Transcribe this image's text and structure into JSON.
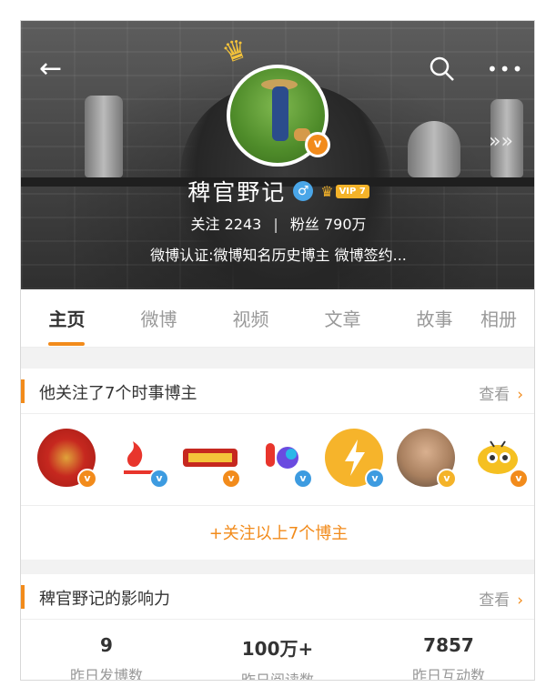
{
  "header": {
    "back_icon": "←",
    "search_icon": "⚲",
    "more_icon": "•••",
    "forward_icon": "»»",
    "name": "稗官野记",
    "gender_icon": "♂",
    "vip_label": "VIP 7",
    "verified_symbol": "v",
    "follow_label": "关注",
    "follow_count": "2243",
    "separator": "|",
    "fans_label": "粉丝",
    "fans_count": "790万",
    "certification": "微博认证:微博知名历史博主 微博签约..."
  },
  "tabs": [
    {
      "label": "主页",
      "active": true
    },
    {
      "label": "微博",
      "active": false
    },
    {
      "label": "视频",
      "active": false
    },
    {
      "label": "文章",
      "active": false
    },
    {
      "label": "故事",
      "active": false
    },
    {
      "label": "相册",
      "active": false
    }
  ],
  "following_card": {
    "title": "他关注了7个时事博主",
    "view_label": "查看",
    "chevron": "›",
    "follow_all_label": "+关注以上7个博主",
    "avatars": [
      {
        "name": "emblem",
        "color": "#c6281f",
        "badge": "v",
        "badge_color": "orange"
      },
      {
        "name": "weibo-hot",
        "color": "#ffffff",
        "badge": "v",
        "badge_color": "blue"
      },
      {
        "name": "news-logo",
        "color": "#ffffff",
        "badge": "v",
        "badge_color": "orange"
      },
      {
        "name": "colorful-logo",
        "color": "#ffffff",
        "badge": "v",
        "badge_color": "blue"
      },
      {
        "name": "lightning",
        "color": "#f6b42b",
        "badge": "v",
        "badge_color": "blue"
      },
      {
        "name": "man-photo",
        "color": "#b58f6c",
        "badge": "v",
        "badge_color": "yellow"
      },
      {
        "name": "ant-cartoon",
        "color": "#f5c021",
        "badge": "v",
        "badge_color": "orange"
      }
    ]
  },
  "influence_card": {
    "title": "稗官野记的影响力",
    "view_label": "查看",
    "chevron": "›",
    "metrics": [
      {
        "value": "9",
        "label": "昨日发博数"
      },
      {
        "value": "100万+",
        "label": "昨日阅读数"
      },
      {
        "value": "7857",
        "label": "昨日互动数"
      }
    ]
  },
  "colors": {
    "accent": "#f28b1b",
    "blue": "#3d9be0",
    "gold": "#f4b329"
  }
}
